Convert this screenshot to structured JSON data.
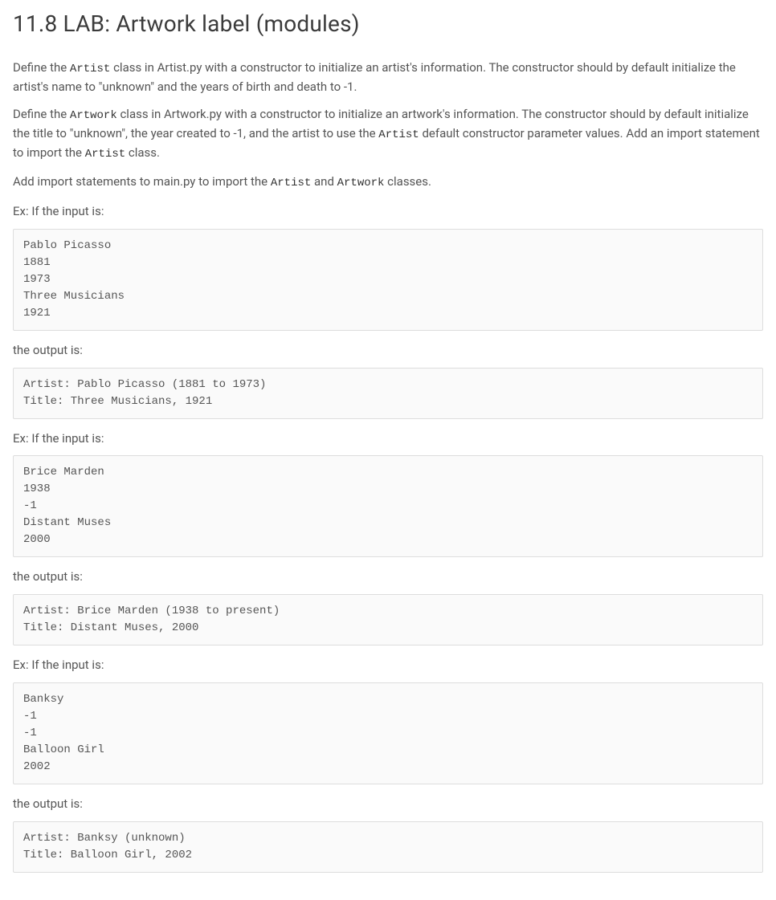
{
  "title": "11.8 LAB: Artwork label (modules)",
  "para1": {
    "pre": "Define the ",
    "code1": "Artist",
    "post": " class in Artist.py with a constructor to initialize an artist's information. The constructor should by default initialize the artist's name to \"unknown\" and the years of birth and death to -1."
  },
  "para2": {
    "pre": "Define the ",
    "code1": "Artwork",
    "mid1": " class in Artwork.py with a constructor to initialize an artwork's information. The constructor should by default initialize the title to \"unknown\", the year created to -1, and the artist to use the ",
    "code2": "Artist",
    "mid2": " default constructor parameter values. Add an import statement to import the ",
    "code3": "Artist",
    "post": " class."
  },
  "para3": {
    "pre": "Add import statements to main.py to import the ",
    "code1": "Artist",
    "mid1": " and ",
    "code2": "Artwork",
    "post": " classes."
  },
  "labels": {
    "exInput": "Ex: If the input is:",
    "outputIs": "the output is:"
  },
  "code_input1": "Pablo Picasso\n1881\n1973\nThree Musicians\n1921",
  "code_output1": "Artist: Pablo Picasso (1881 to 1973)\nTitle: Three Musicians, 1921",
  "code_input2": "Brice Marden\n1938\n-1\nDistant Muses\n2000",
  "code_output2": "Artist: Brice Marden (1938 to present)\nTitle: Distant Muses, 2000",
  "code_input3": "Banksy\n-1\n-1\nBalloon Girl\n2002",
  "code_output3": "Artist: Banksy (unknown)\nTitle: Balloon Girl, 2002"
}
